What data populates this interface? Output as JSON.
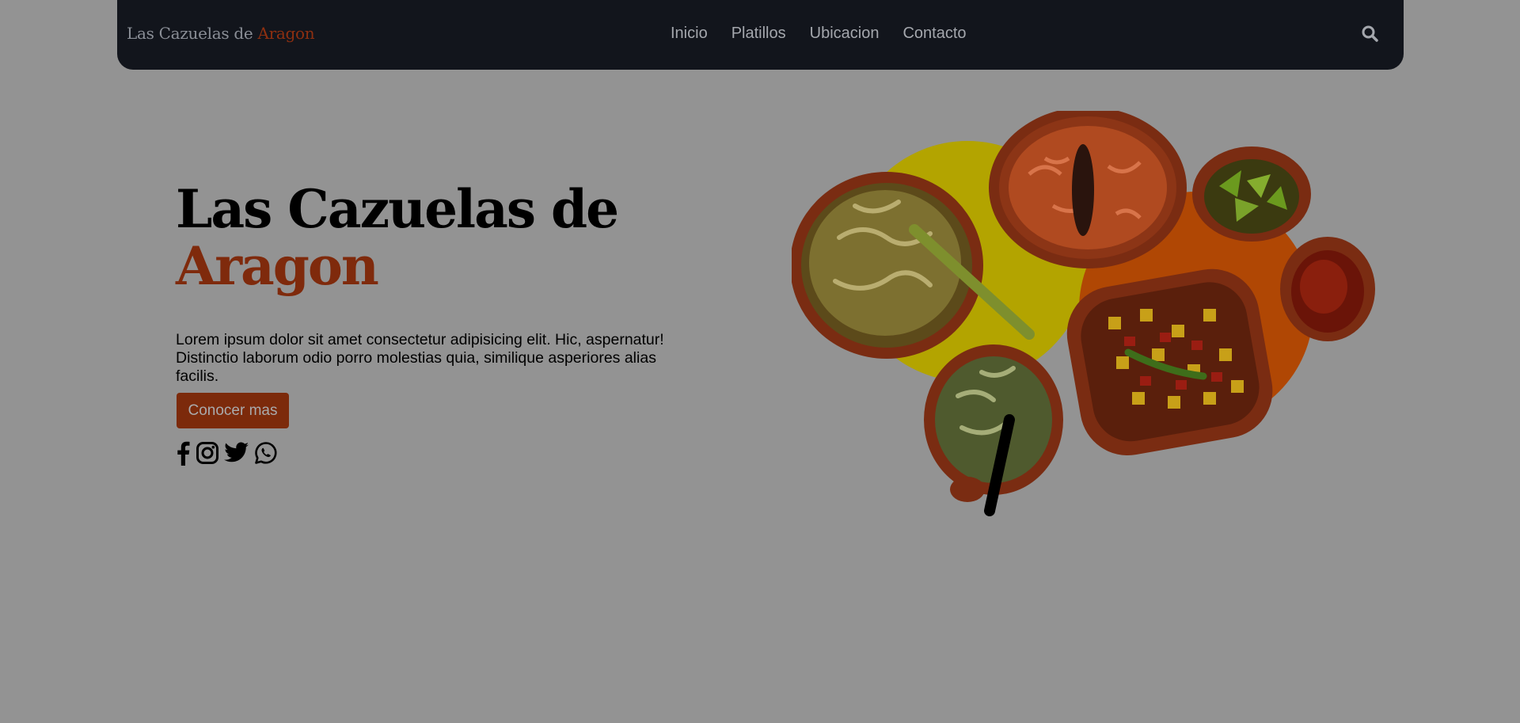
{
  "brand": {
    "name": "Las Cazuelas de ",
    "accent": "Aragon"
  },
  "nav": {
    "items": [
      "Inicio",
      "Platillos",
      "Ubicacion",
      "Contacto"
    ],
    "search_icon": "search-icon"
  },
  "hero": {
    "title_line1": "Las Cazuelas de",
    "title_line2": "Aragon",
    "description": "Lorem ipsum dolor sit amet consectetur adipisicing elit. Hic, aspernatur! Distinctio laborum odio porro molestias quia, similique asperiores alias facilis.",
    "cta_label": "Conocer mas",
    "socials": [
      "facebook-icon",
      "instagram-icon",
      "twitter-icon",
      "whatsapp-icon"
    ]
  },
  "colors": {
    "page_bg": "#939393",
    "navbar_bg": "#12151c",
    "accent": "#7f2a0c",
    "yellow_circle": "#b5a600",
    "orange_circle": "#b54a04"
  }
}
